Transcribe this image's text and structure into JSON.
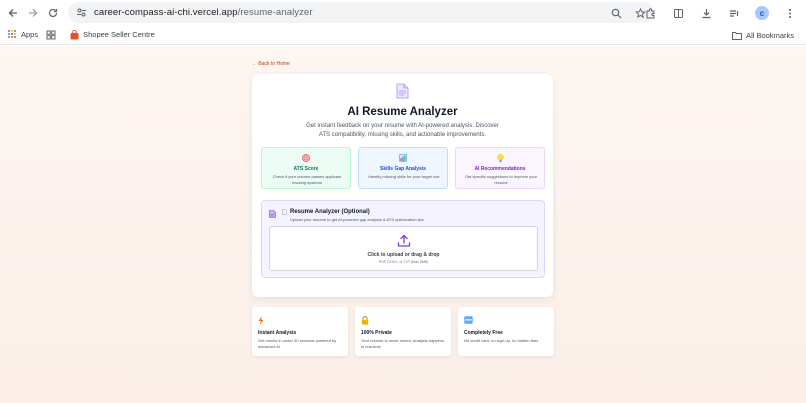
{
  "browser": {
    "url_host": "career-compass-ai-chi.vercel.app",
    "url_path": "/resume-analyzer",
    "bookmarks": [
      {
        "label": "Apps"
      },
      {
        "label": "Shopee Seller Centre"
      }
    ],
    "all_bookmarks": "All Bookmarks"
  },
  "page": {
    "back_link": "← Back to Home",
    "title": "AI Resume Analyzer",
    "subtitle": "Get instant feedback on your resume with AI-powered analysis. Discover ATS compatibility, missing skills, and actionable improvements.",
    "features": [
      {
        "title": "ATS Score",
        "desc": "Check if your resume passes applicant tracking systems",
        "icon": "target-icon"
      },
      {
        "title": "Skills Gap Analysis",
        "desc": "Identify missing skills for your target role",
        "icon": "bar-chart-icon"
      },
      {
        "title": "AI Recommendations",
        "desc": "Get specific suggestions to improve your resume",
        "icon": "lightbulb-icon"
      }
    ],
    "upload": {
      "title": "Resume Analyzer (Optional)",
      "subtitle": "Upload your resume to get AI-powered gap analysis & ATS optimization tips",
      "cta": "Click to upload or drag & drop",
      "hint": "PDF, DOCX, or TXT (Max 5MB)"
    },
    "benefits": [
      {
        "title": "Instant Analysis",
        "desc": "Get results in under 30 seconds powered by advanced AI",
        "icon": "lightning-icon"
      },
      {
        "title": "100% Private",
        "desc": "Your resume is never stored. Analysis happens in real-time",
        "icon": "lock-icon"
      },
      {
        "title": "Completely Free",
        "desc": "No credit card, no sign-up, no hidden fees",
        "icon": "free-badge-icon"
      }
    ]
  },
  "colors": {
    "accent": "#7c3aed",
    "back_link": "#c2410c"
  }
}
